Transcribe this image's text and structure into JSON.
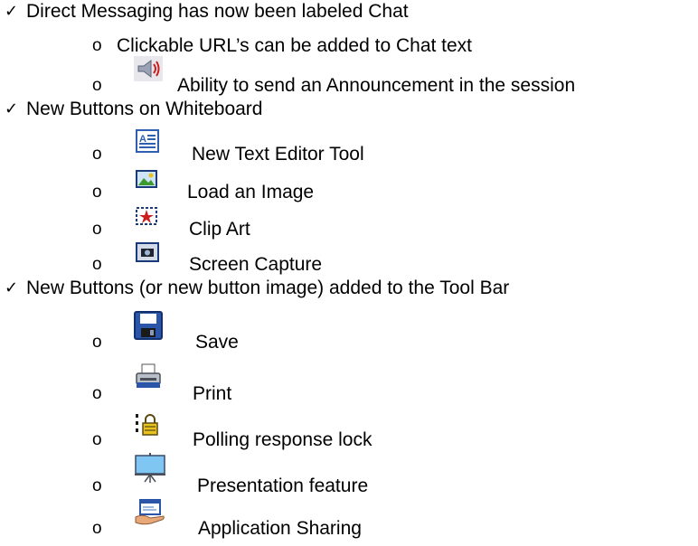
{
  "sections": [
    {
      "marker": "✓",
      "text": "Direct Messaging has now been labeled Chat",
      "items": [
        {
          "bullet": "o",
          "icon": "",
          "text": "Clickable URL’s can be added to Chat text"
        },
        {
          "bullet": "o",
          "icon": "announcement-megaphone-icon",
          "text": "Ability to send an Announcement in the session"
        }
      ]
    },
    {
      "marker": "✓",
      "text": "New Buttons on Whiteboard",
      "items": [
        {
          "bullet": "o",
          "icon": "text-editor-icon",
          "text": "New Text Editor Tool"
        },
        {
          "bullet": "o",
          "icon": "load-image-icon",
          "text": "Load an Image"
        },
        {
          "bullet": "o",
          "icon": "clip-art-icon",
          "text": "Clip Art"
        },
        {
          "bullet": "o",
          "icon": "screen-capture-icon",
          "text": "Screen Capture"
        }
      ]
    },
    {
      "marker": "✓",
      "text": "New Buttons (or new button image) added to the Tool Bar",
      "items": [
        {
          "bullet": "o",
          "icon": "save-floppy-icon",
          "text": "Save"
        },
        {
          "bullet": "o",
          "icon": "print-icon",
          "text": "Print"
        },
        {
          "bullet": "o",
          "icon": "polling-lock-icon",
          "text": "Polling response lock"
        },
        {
          "bullet": "o",
          "icon": "presentation-screen-icon",
          "text": "Presentation feature"
        },
        {
          "bullet": "o",
          "icon": "application-sharing-icon",
          "text": "Application Sharing"
        }
      ]
    }
  ],
  "colors": {
    "icon_blue": "#2f5fb3",
    "icon_dark": "#1a3a7a",
    "accent_red": "#cc1e1e"
  }
}
